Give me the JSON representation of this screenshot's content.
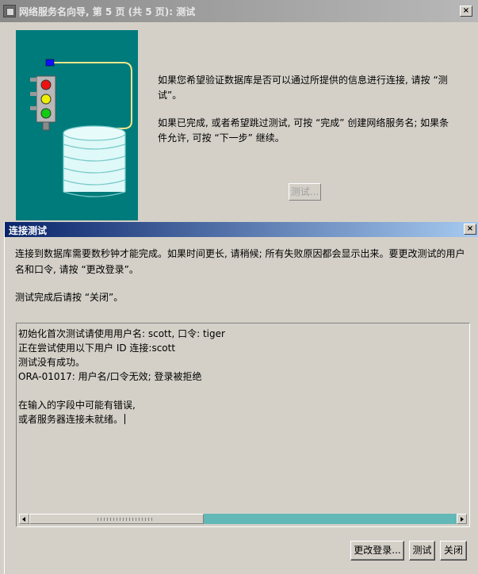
{
  "wizard": {
    "title": "网络服务名向导, 第 5 页 (共 5 页): 测试",
    "paragraph1_line1": "如果您希望验证数据库是否可以通过所提供的信息进行连接, 请按 “测",
    "paragraph1_line2": "试”。",
    "paragraph2_line1": "如果已完成, 或者希望跳过测试, 可按 “完成” 创建网络服务名; 如果条",
    "paragraph2_line2": "件允许, 可按 “下一步” 继续。",
    "test_button_label": "测试..."
  },
  "dialog": {
    "title": "连接测试",
    "info_line1": "连接到数据库需要数秒钟才能完成。如果时间更长, 请稍候; 所有失败原因都会显示出来。要更改测试的用户",
    "info_line2": "名和口令, 请按 “更改登录”。",
    "close_hint": "测试完成后请按 “关闭”。",
    "output_lines": [
      "初始化首次测试请使用用户名: scott, 口令: tiger",
      "正在尝试使用以下用户 ID 连接:scott",
      "测试没有成功。",
      "ORA-01017: 用户名/口令无效; 登录被拒绝",
      "",
      "在输入的字段中可能有错误,",
      "或者服务器连接未就绪。"
    ],
    "buttons": {
      "change_login": "更改登录...",
      "test": "测试",
      "close": "关闭"
    }
  },
  "icons": {
    "window_close": "×"
  },
  "colors": {
    "illustration_bg": "#007b7b",
    "dialog_title_bg": "#0a246a",
    "inactive_title_bg": "#8a8a8a",
    "scroll_track": "#62b8b6"
  }
}
